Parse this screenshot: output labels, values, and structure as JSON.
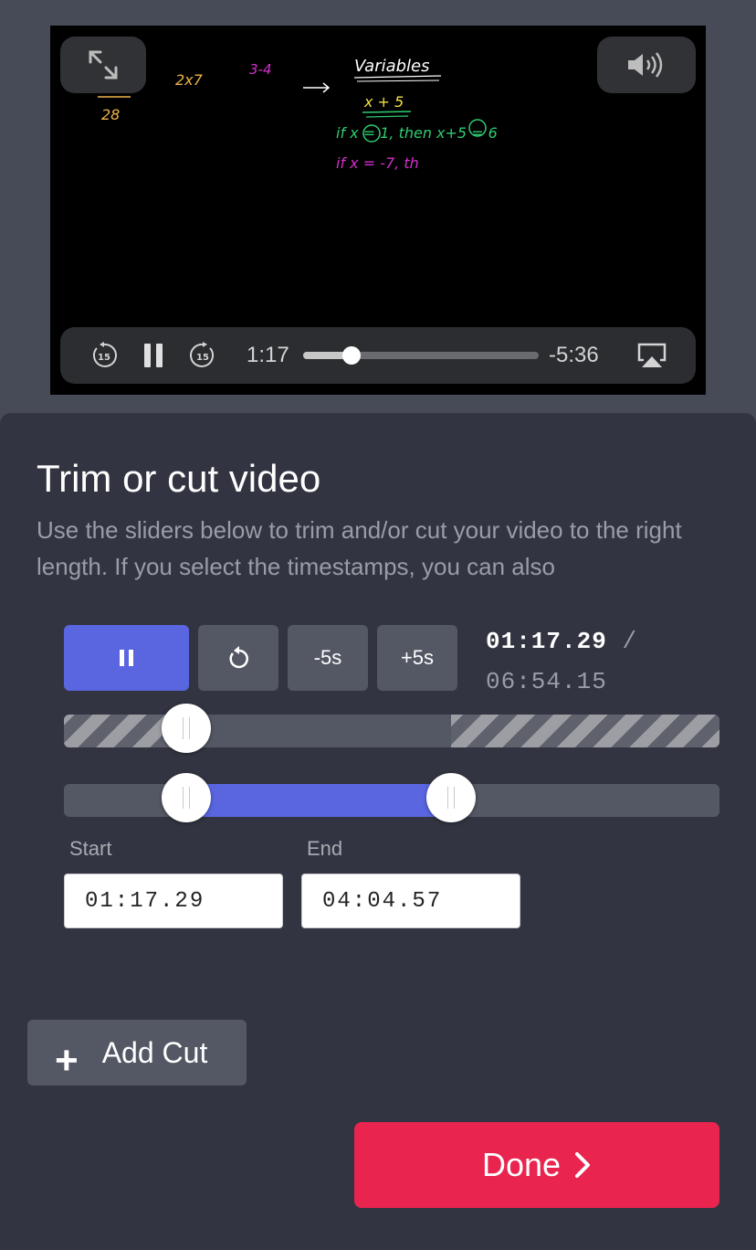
{
  "video": {
    "board": {
      "calc_top": "2x7",
      "calc_bottom": "28",
      "expr": "3-4",
      "title": "Variables",
      "line1": "x + 5",
      "line2": "if x = 1, then x+5 = 6",
      "line3": "if x = -7, th"
    },
    "player": {
      "elapsed": "1:17",
      "remaining": "-5:36",
      "skip_back_seconds": "15",
      "skip_forward_seconds": "15",
      "progress_fraction": 0.205
    }
  },
  "panel": {
    "title": "Trim or cut video",
    "description": "Use the sliders below to trim and/or cut your video to the right length. If you select the timestamps, you can also",
    "controls": {
      "minus_label": "-5s",
      "plus_label": "+5s"
    },
    "clock": {
      "current": "01:17.29",
      "separator": "/",
      "total": "06:54.15"
    },
    "playhead_fraction": 0.187,
    "selection": {
      "start_fraction": 0.187,
      "end_fraction": 0.591
    },
    "start_label": "Start",
    "end_label": "End",
    "start_value": "01:17.29",
    "end_value": "04:04.57",
    "add_cut_label": "Add Cut",
    "done_label": "Done"
  },
  "colors": {
    "accent": "#5a66e0",
    "done": "#e8244f",
    "panel_bg": "#323441",
    "board_yellow": "#f0b34a",
    "board_magenta": "#d42fc9",
    "board_green": "#2ecc71"
  },
  "icons": [
    "expand-icon",
    "volume-icon",
    "skip-back-15-icon",
    "pause-icon",
    "skip-forward-15-icon",
    "airplay-icon",
    "restart-icon",
    "plus-icon",
    "chevron-right-icon"
  ]
}
